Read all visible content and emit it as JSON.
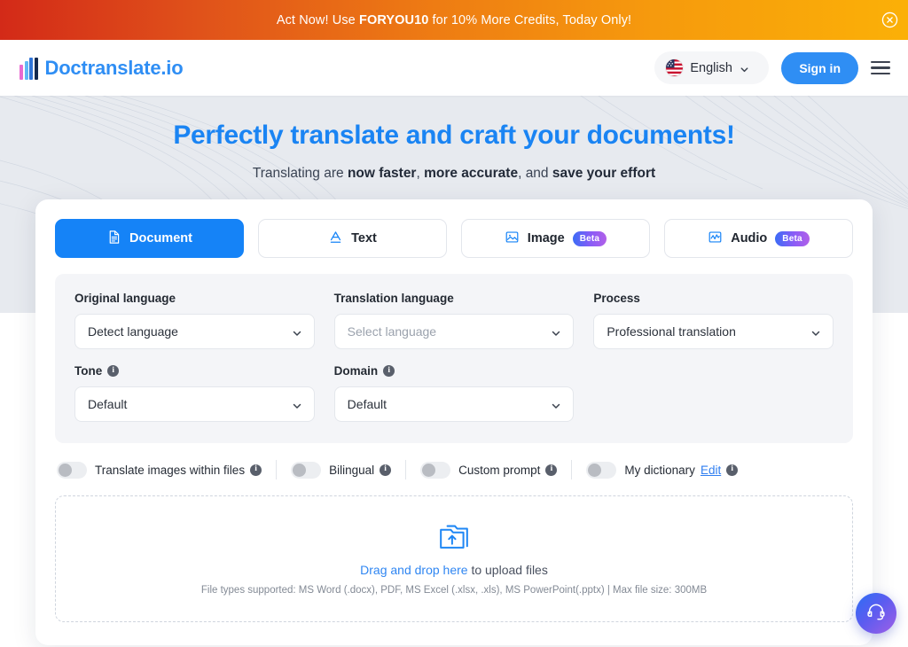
{
  "promo": {
    "prefix": "Act Now! Use ",
    "code": "FORYOU10",
    "suffix": " for 10% More Credits, Today Only!",
    "close_icon": "close-circle-icon"
  },
  "header": {
    "brand_name": "Doctranslate.io",
    "brand_bar_colors": [
      "#e86bd0",
      "#5fb8f5",
      "#2f74d8",
      "#13294e"
    ],
    "language": {
      "label": "English",
      "flag_icon": "us-flag-icon",
      "chevron_icon": "chevron-down-icon"
    },
    "sign_in_label": "Sign in",
    "menu_icon": "hamburger-menu-icon"
  },
  "hero": {
    "title": "Perfectly translate and craft your documents!",
    "subtitle_parts": [
      {
        "text": "Translating are ",
        "bold": false
      },
      {
        "text": "now faster",
        "bold": true
      },
      {
        "text": ", ",
        "bold": false
      },
      {
        "text": "more accurate",
        "bold": true
      },
      {
        "text": ", and ",
        "bold": false
      },
      {
        "text": "save your effort",
        "bold": true
      }
    ]
  },
  "tabs": [
    {
      "label": "Document",
      "icon": "document-icon",
      "active": true,
      "badge": null
    },
    {
      "label": "Text",
      "icon": "text-a-icon",
      "active": false,
      "badge": null
    },
    {
      "label": "Image",
      "icon": "image-icon",
      "active": false,
      "badge": "Beta"
    },
    {
      "label": "Audio",
      "icon": "audio-waveform-icon",
      "active": false,
      "badge": "Beta"
    }
  ],
  "settings": {
    "original_language": {
      "label": "Original language",
      "value": "Detect language",
      "is_placeholder": false,
      "has_info": false
    },
    "translation_language": {
      "label": "Translation language",
      "value": "Select language",
      "is_placeholder": true,
      "has_info": false
    },
    "process": {
      "label": "Process",
      "value": "Professional translation",
      "is_placeholder": false,
      "has_info": false
    },
    "tone": {
      "label": "Tone",
      "value": "Default",
      "is_placeholder": false,
      "has_info": true
    },
    "domain": {
      "label": "Domain",
      "value": "Default",
      "is_placeholder": false,
      "has_info": true
    },
    "info_char": "i"
  },
  "toggles": [
    {
      "label": "Translate images within files",
      "on": false,
      "has_info": true,
      "link": null
    },
    {
      "label": "Bilingual",
      "on": false,
      "has_info": true,
      "link": null
    },
    {
      "label": "Custom prompt",
      "on": false,
      "has_info": true,
      "link": null
    },
    {
      "label": "My dictionary",
      "on": false,
      "has_info": true,
      "link": "Edit"
    }
  ],
  "dropzone": {
    "icon": "folder-upload-icon",
    "link_text": "Drag and drop here",
    "main_suffix": " to upload files",
    "sub_text": "File types supported: MS Word (.docx), PDF, MS Excel (.xlsx, .xls), MS PowerPoint(.pptx) | Max file size: 300MB"
  },
  "support": {
    "icon": "headset-support-icon"
  },
  "colors": {
    "accent_blue": "#1583f7",
    "brand_blue": "#2f8ef4",
    "hero_bg": "#e7eaef",
    "panel_bg": "#f4f5f8",
    "beta_gradient_start": "#3b6cf6",
    "beta_gradient_end": "#b160e8"
  }
}
